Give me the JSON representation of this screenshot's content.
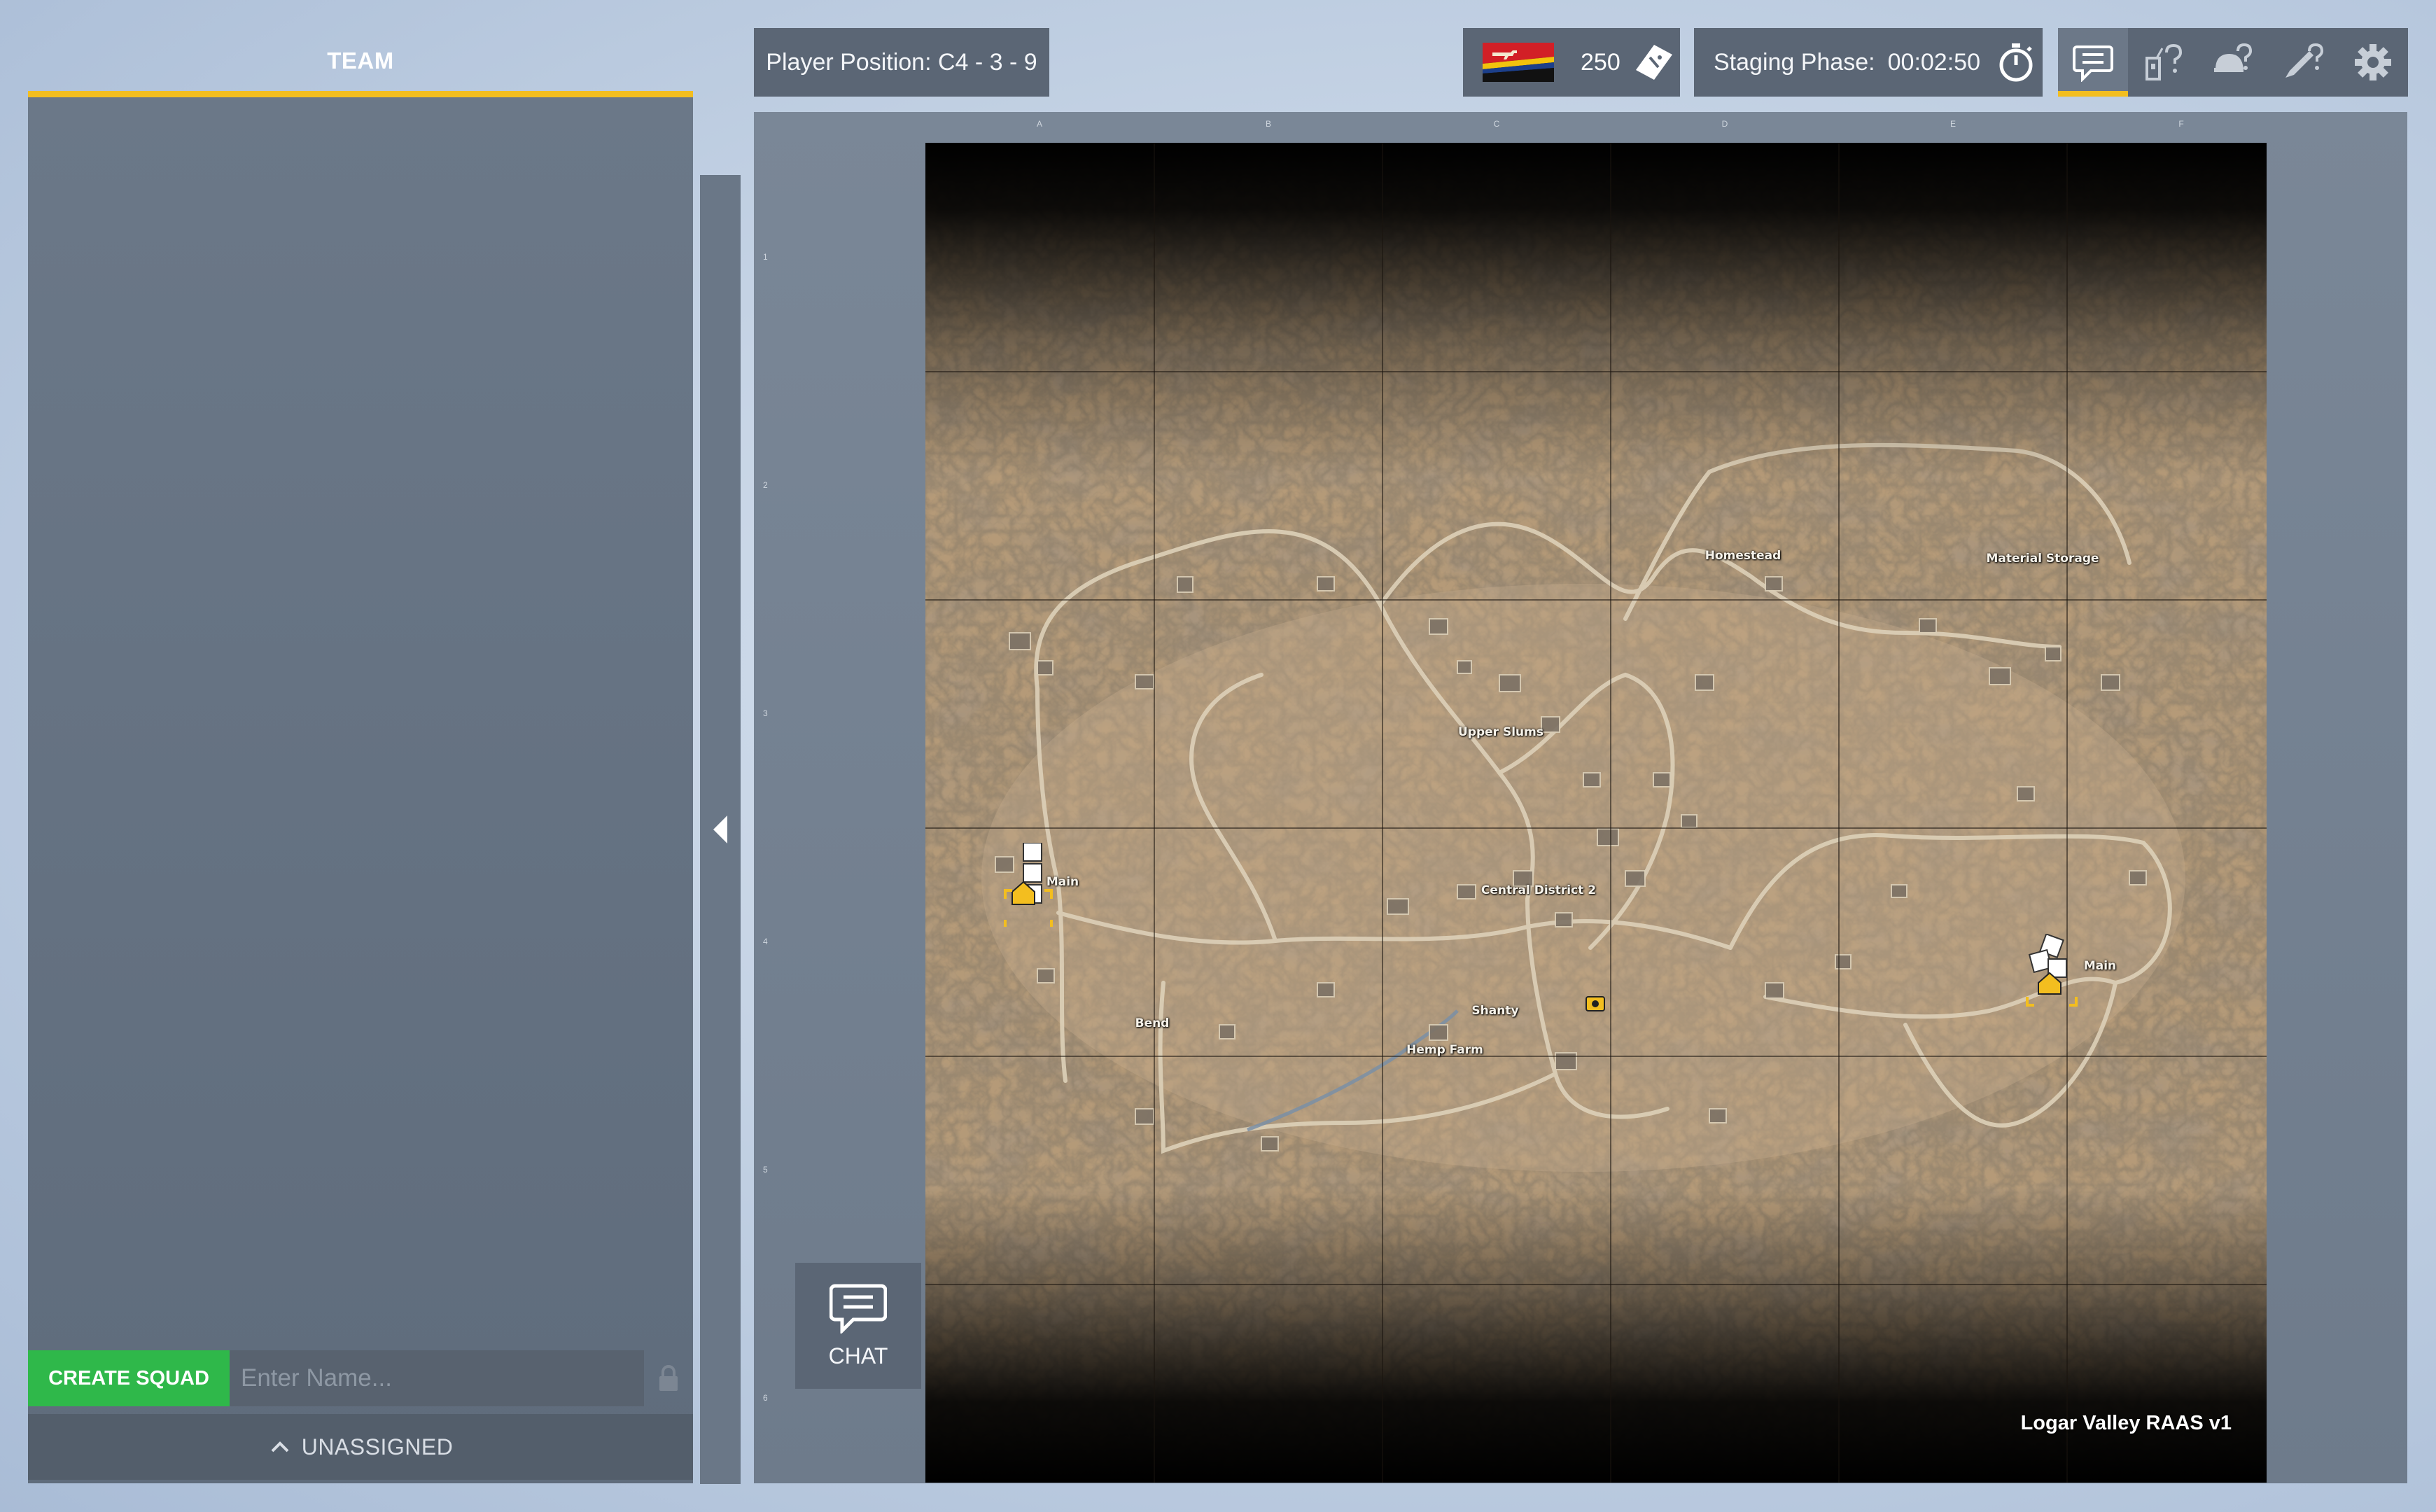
{
  "team_panel": {
    "tab_label": "TEAM",
    "create_squad_label": "CREATE SQUAD",
    "squad_name_placeholder": "Enter Name...",
    "squad_name_value": "",
    "unassigned_label": "UNASSIGNED"
  },
  "header": {
    "player_position": "Player Position: C4 - 3 - 9",
    "tickets": "250",
    "staging_label": "Staging Phase:",
    "staging_time": "00:02:50",
    "icons": [
      "chat-icon",
      "commander-help-icon",
      "helmet-help-icon",
      "rocket-help-icon",
      "gear-icon"
    ]
  },
  "map": {
    "title": "Logar Valley RAAS v1",
    "column_labels": [
      "A",
      "B",
      "C",
      "D",
      "E",
      "F"
    ],
    "row_labels": [
      "1",
      "2",
      "3",
      "4",
      "5",
      "6"
    ],
    "locations": [
      {
        "id": "homestead",
        "name": "Homestead"
      },
      {
        "id": "material-storage",
        "name": "Material Storage"
      },
      {
        "id": "upper-slums",
        "name": "Upper Slums"
      },
      {
        "id": "central-district-2",
        "name": "Central District 2"
      },
      {
        "id": "shanty",
        "name": "Shanty"
      },
      {
        "id": "hemp-farm",
        "name": "Hemp Farm"
      },
      {
        "id": "bend",
        "name": "Bend"
      },
      {
        "id": "west-main",
        "name": "Main"
      },
      {
        "id": "east-main",
        "name": "Main"
      }
    ],
    "colors": {
      "accent": "#f3be1f",
      "create_squad": "#2fb84a",
      "panel": "#5b6675"
    }
  },
  "chat": {
    "label": "CHAT"
  }
}
